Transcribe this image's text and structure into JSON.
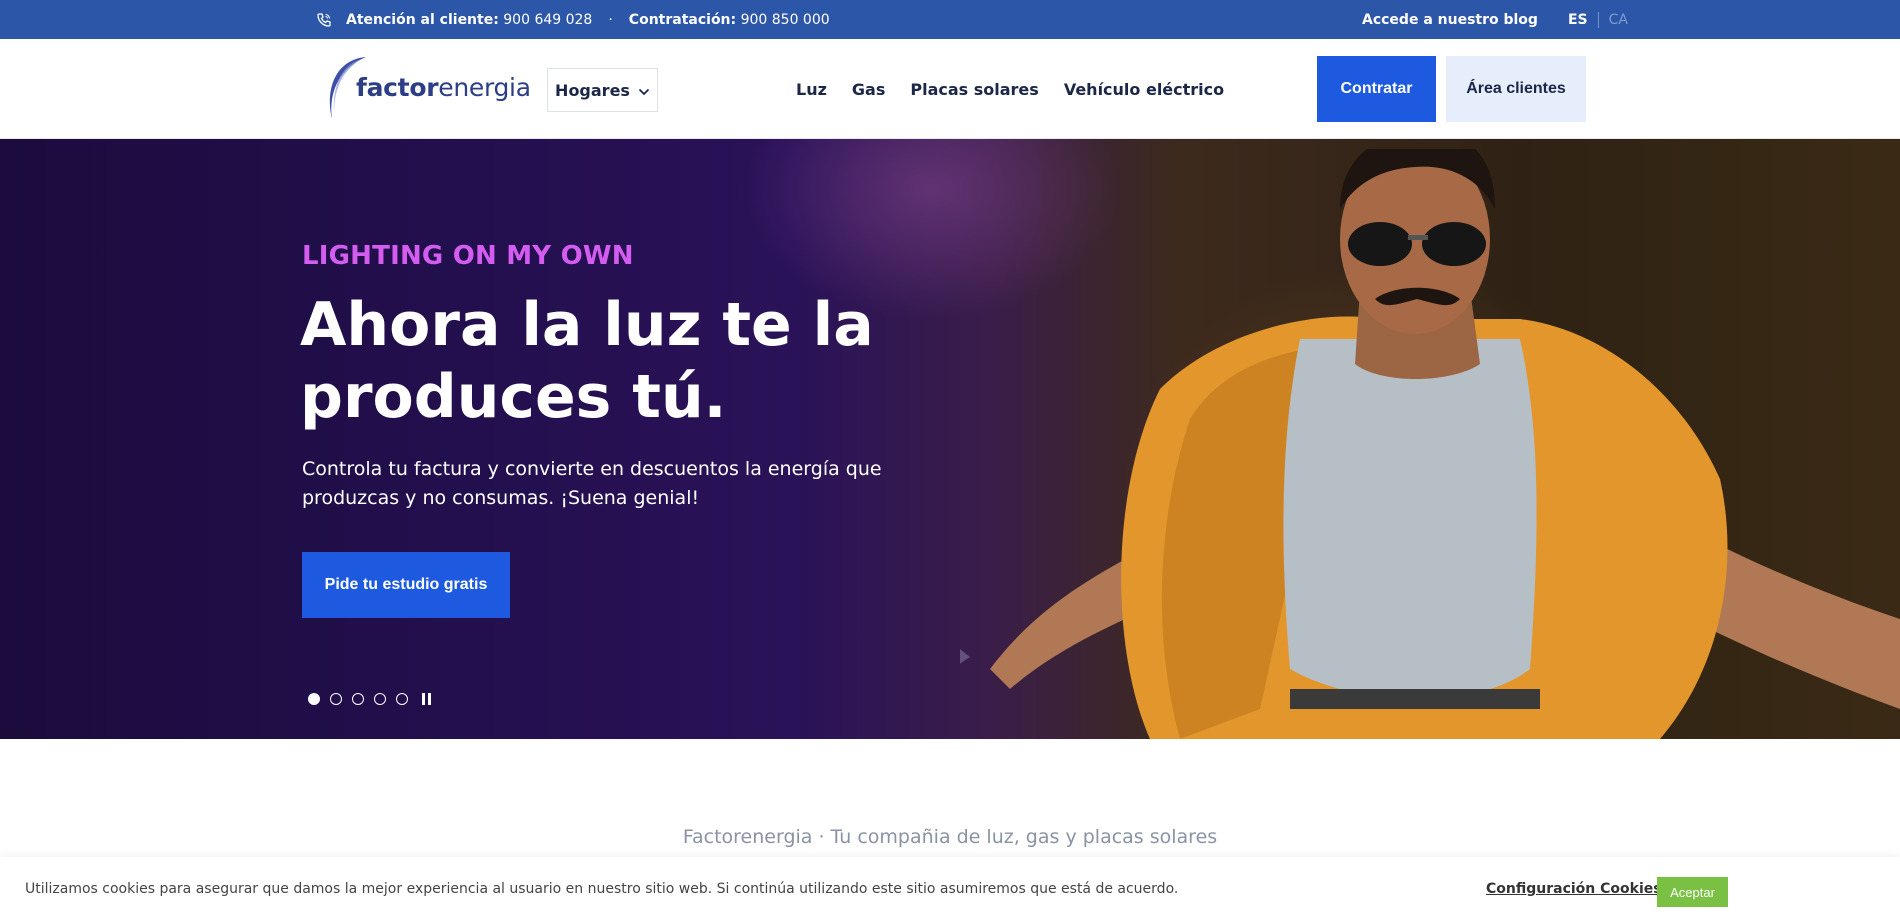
{
  "topbar": {
    "customer_label": "Atención al cliente:",
    "customer_phone": "900 649 028",
    "separator": "·",
    "hiring_label": "Contratación:",
    "hiring_phone": "900 850 000",
    "blog_link": "Accede a nuestro blog",
    "lang_es": "ES",
    "lang_ca": "CA"
  },
  "header": {
    "logo_bold": "factor",
    "logo_regular": "energia",
    "segment_select": "Hogares",
    "nav": [
      "Luz",
      "Gas",
      "Placas solares",
      "Vehículo eléctrico"
    ],
    "contratar": "Contratar",
    "area_clientes": "Área clientes"
  },
  "hero": {
    "kicker": "LIGHTING ON MY OWN",
    "title": "Ahora la luz te la produces tú.",
    "subtitle": "Controla tu factura y convierte en descuentos la energía que produzcas y no consumas. ¡Suena genial!",
    "cta": "Pide tu estudio gratis",
    "slides_total": 5,
    "slide_active": 1
  },
  "tagline": "Factorenergia · Tu compañia de luz, gas y placas solares",
  "cookie": {
    "message": "Utilizamos cookies para asegurar que damos la mejor experiencia al usuario en nuestro sitio web. Si continúa utilizando este sitio asumiremos que está de acuerdo.",
    "config": "Configuración Cookies",
    "accept": "Aceptar"
  },
  "colors": {
    "topbar": "#2c56a8",
    "primary": "#1d5ae0",
    "kicker": "#d45cf0",
    "accept": "#7ac143"
  }
}
